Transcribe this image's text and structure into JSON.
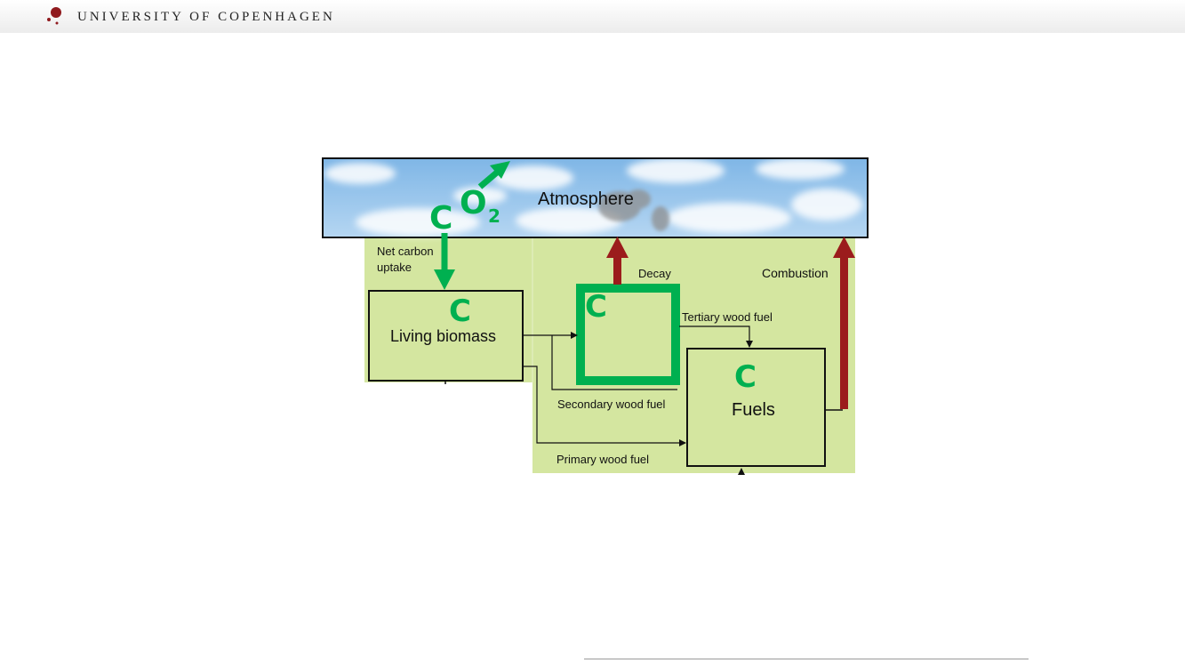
{
  "header": {
    "logo_text": "UNIVERSITY OF COPENHAGEN"
  },
  "diagram": {
    "atmosphere_label": "Atmosphere",
    "co2_c": "C",
    "co2_o": "O",
    "co2_sub": "2",
    "net_uptake_line1": "Net carbon",
    "net_uptake_line2": "uptake",
    "living_biomass_c": "C",
    "living_biomass_label": "Living biomass",
    "dead_pool_c": "C",
    "fuels_c": "C",
    "fuels_label": "Fuels",
    "decay_label": "Decay",
    "combustion_label": "Combustion",
    "tertiary_label": "Tertiary wood fuel",
    "secondary_label": "Secondary wood fuel",
    "primary_label": "Primary wood fuel"
  },
  "colors": {
    "carbon_green": "#00b050",
    "emission_red": "#9b1c1c",
    "background_green": "#d4e6a0",
    "logo_red": "#901a1e"
  }
}
